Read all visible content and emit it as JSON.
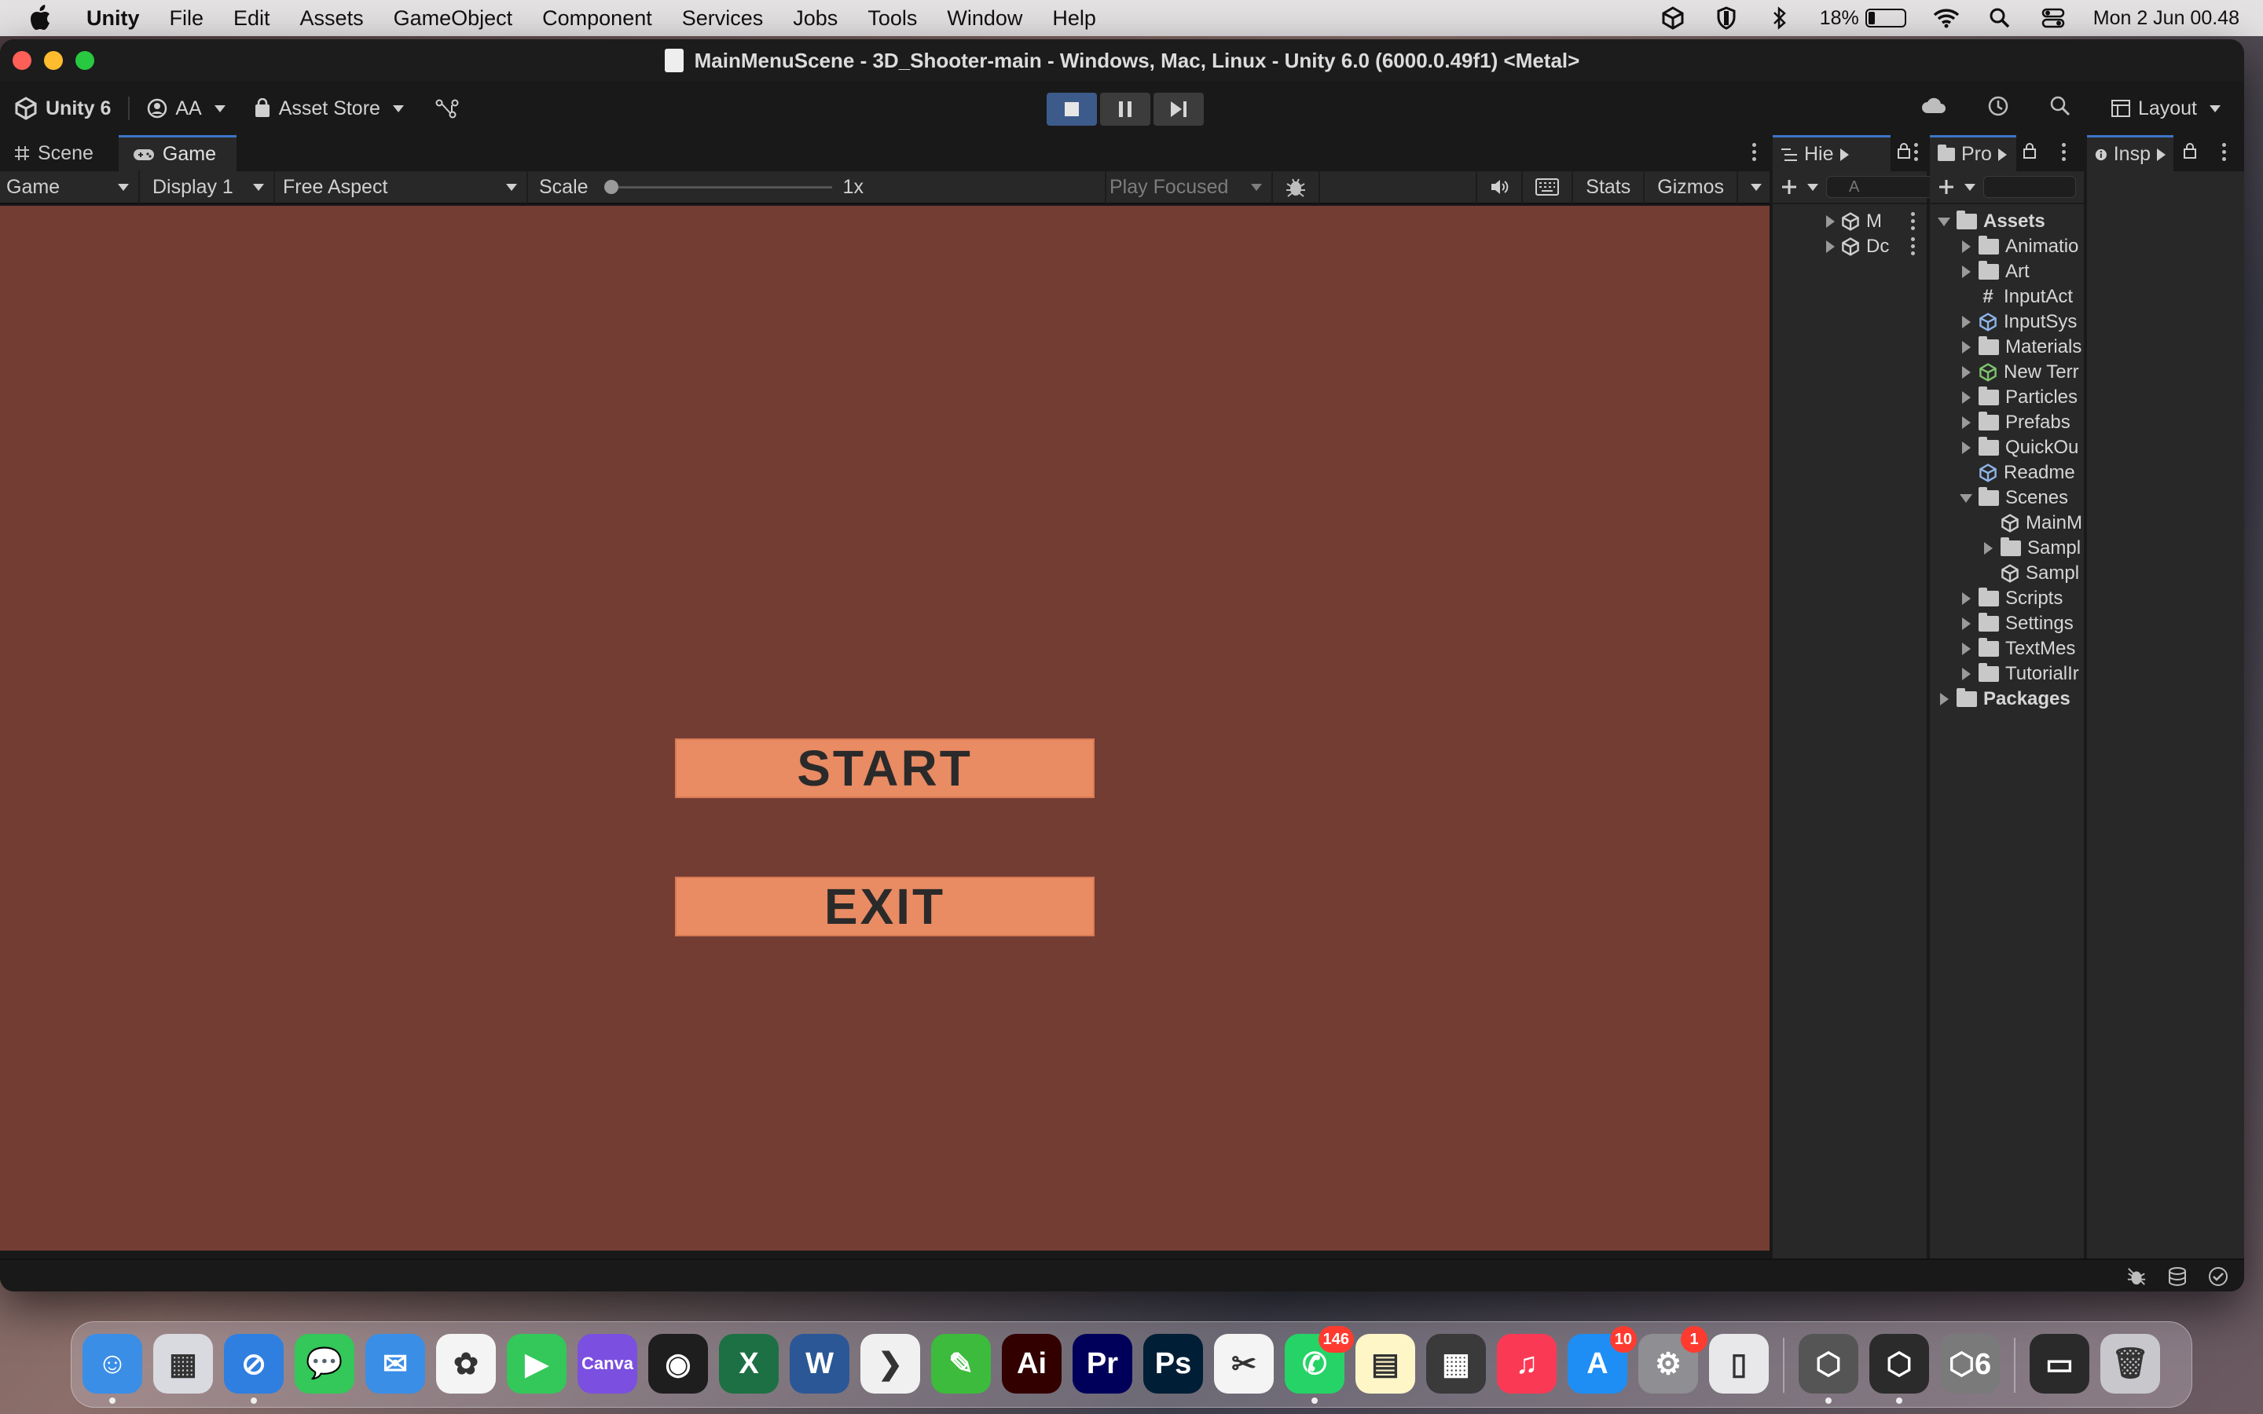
{
  "menubar": {
    "app_name": "Unity",
    "items": [
      "File",
      "Edit",
      "Assets",
      "GameObject",
      "Component",
      "Services",
      "Jobs",
      "Tools",
      "Window",
      "Help"
    ],
    "battery": "18%",
    "battery_level": 0.18,
    "clock": "Mon 2 Jun  00.48"
  },
  "window": {
    "title": "MainMenuScene - 3D_Shooter-main - Windows, Mac, Linux - Unity 6.0 (6000.0.49f1) <Metal>"
  },
  "toolbar": {
    "unity_label": "Unity 6",
    "account_label": "AA",
    "asset_store_label": "Asset Store",
    "layout_label": "Layout"
  },
  "game_panel": {
    "tabs": [
      {
        "label": "Scene"
      },
      {
        "label": "Game"
      }
    ],
    "mode_dropdown": "Game",
    "display_dropdown": "Display 1",
    "aspect_dropdown": "Free Aspect",
    "scale_label": "Scale",
    "scale_value": "1x",
    "play_focused": "Play Focused",
    "stats_label": "Stats",
    "gizmos_label": "Gizmos",
    "viewport_color": "#743d34",
    "buttons": {
      "start": "START",
      "exit": "EXIT"
    },
    "button_color": "#e98b63"
  },
  "hierarchy": {
    "tab_label": "Hie",
    "search_placeholder": "A",
    "rows": [
      "M",
      "Dc"
    ]
  },
  "project": {
    "tab_label": "Pro",
    "tree": [
      {
        "label": "Assets",
        "type": "folder-open",
        "depth": 0,
        "expand": "down",
        "bold": true
      },
      {
        "label": "Animatio",
        "type": "folder",
        "depth": 1,
        "expand": "right"
      },
      {
        "label": "Art",
        "type": "folder",
        "depth": 1,
        "expand": "right"
      },
      {
        "label": "InputAct",
        "type": "script",
        "depth": 1,
        "expand": ""
      },
      {
        "label": "InputSys",
        "type": "asset",
        "depth": 1,
        "expand": "right"
      },
      {
        "label": "Materials",
        "type": "folder",
        "depth": 1,
        "expand": "right"
      },
      {
        "label": "New Terr",
        "type": "terrain",
        "depth": 1,
        "expand": "right"
      },
      {
        "label": "Particles",
        "type": "folder",
        "depth": 1,
        "expand": "right"
      },
      {
        "label": "Prefabs",
        "type": "folder",
        "depth": 1,
        "expand": "right"
      },
      {
        "label": "QuickOu",
        "type": "folder",
        "depth": 1,
        "expand": "right"
      },
      {
        "label": "Readme",
        "type": "asset",
        "depth": 1,
        "expand": ""
      },
      {
        "label": "Scenes",
        "type": "folder-open",
        "depth": 1,
        "expand": "down"
      },
      {
        "label": "MainM",
        "type": "scene",
        "depth": 2,
        "expand": ""
      },
      {
        "label": "Sampl",
        "type": "folder",
        "depth": 2,
        "expand": "right"
      },
      {
        "label": "Sampl",
        "type": "scene",
        "depth": 2,
        "expand": ""
      },
      {
        "label": "Scripts",
        "type": "folder",
        "depth": 1,
        "expand": "right"
      },
      {
        "label": "Settings",
        "type": "folder",
        "depth": 1,
        "expand": "right"
      },
      {
        "label": "TextMes",
        "type": "folder",
        "depth": 1,
        "expand": "right"
      },
      {
        "label": "TutorialIr",
        "type": "folder",
        "depth": 1,
        "expand": "right"
      },
      {
        "label": "Packages",
        "type": "folder",
        "depth": 0,
        "expand": "right",
        "bold": true
      }
    ]
  },
  "inspector": {
    "tab_label": "Insp"
  },
  "dock": {
    "apps": [
      {
        "name": "finder",
        "color": "#3a8ee6",
        "glyph": "☺",
        "running": true
      },
      {
        "name": "launchpad",
        "color": "#d9d9e0",
        "glyph": "▦",
        "running": false
      },
      {
        "name": "safari",
        "color": "#2f7fe0",
        "glyph": "⊘",
        "running": true
      },
      {
        "name": "messages",
        "color": "#34c759",
        "glyph": "💬",
        "running": false
      },
      {
        "name": "mail",
        "color": "#3a8ee6",
        "glyph": "✉",
        "running": false
      },
      {
        "name": "photos",
        "color": "#f4f4f4",
        "glyph": "✿",
        "running": false
      },
      {
        "name": "facetime",
        "color": "#34c759",
        "glyph": "▶",
        "running": false
      },
      {
        "name": "canva",
        "color": "#7b4fe0",
        "glyph": "Canva",
        "running": false
      },
      {
        "name": "figma",
        "color": "#1e1e1e",
        "glyph": "◉",
        "running": false
      },
      {
        "name": "excel",
        "color": "#1d7044",
        "glyph": "X",
        "running": false
      },
      {
        "name": "word",
        "color": "#2b5797",
        "glyph": "W",
        "running": false
      },
      {
        "name": "vscode",
        "color": "#f0f0f0",
        "glyph": "❯",
        "running": false
      },
      {
        "name": "notes-pen",
        "color": "#3dbb3d",
        "glyph": "✎",
        "running": false
      },
      {
        "name": "illustrator",
        "color": "#330000",
        "glyph": "Ai",
        "running": false
      },
      {
        "name": "premiere",
        "color": "#00005b",
        "glyph": "Pr",
        "running": false
      },
      {
        "name": "photoshop",
        "color": "#001e36",
        "glyph": "Ps",
        "running": false
      },
      {
        "name": "capcut",
        "color": "#f4f4f4",
        "glyph": "✂",
        "running": false
      },
      {
        "name": "whatsapp",
        "color": "#25d366",
        "glyph": "✆",
        "running": true,
        "badge": "146"
      },
      {
        "name": "notes",
        "color": "#fff6c8",
        "glyph": "▤",
        "running": false
      },
      {
        "name": "calculator",
        "color": "#3a3a3a",
        "glyph": "▦",
        "running": false
      },
      {
        "name": "music",
        "color": "#fa3a55",
        "glyph": "♫",
        "running": false
      },
      {
        "name": "app-store",
        "color": "#1e8ef5",
        "glyph": "A",
        "running": false,
        "badge": "10"
      },
      {
        "name": "system-settings",
        "color": "#8e8e93",
        "glyph": "⚙",
        "running": false,
        "badge": "1"
      },
      {
        "name": "iphone-mirroring",
        "color": "#e8e8ea",
        "glyph": "▯",
        "running": false
      },
      {
        "name": "unity-hub",
        "color": "#555",
        "glyph": "⬡",
        "running": true
      },
      {
        "name": "unity-editor",
        "color": "#2b2b2b",
        "glyph": "⬡",
        "running": true
      },
      {
        "name": "unity-6",
        "color": "#7a7a7a",
        "glyph": "⬡6",
        "running": false
      },
      {
        "name": "downloads-stack",
        "color": "#2a2a2a",
        "glyph": "▭",
        "running": false
      },
      {
        "name": "trash",
        "color": "#c7c7cc",
        "glyph": "🗑",
        "running": false
      }
    ]
  }
}
